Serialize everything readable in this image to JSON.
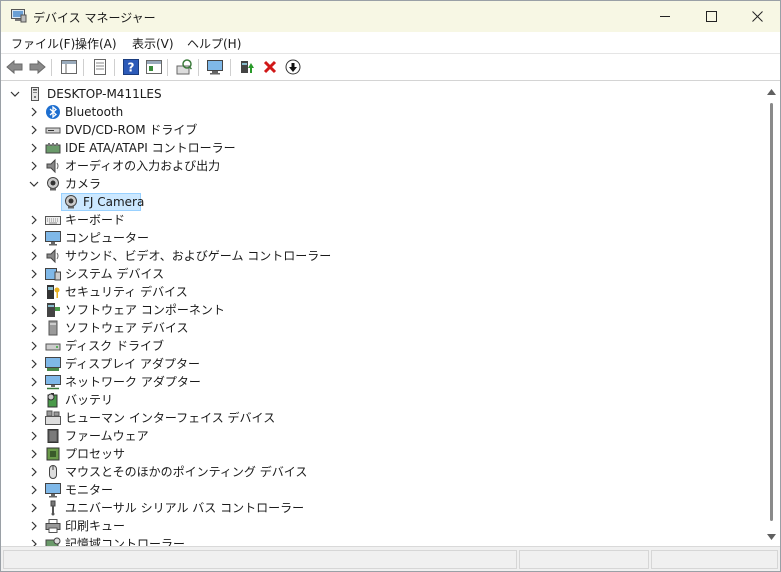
{
  "window": {
    "title": "デバイス マネージャー"
  },
  "menu": {
    "items": [
      "ファイル(F)",
      "操作(A)",
      "表示(V)",
      "ヘルプ(H)"
    ]
  },
  "toolbar": {
    "buttons": [
      "back-arrow-icon",
      "forward-arrow-icon",
      "show-hide-console-tree-icon",
      "properties-icon",
      "help-icon",
      "action-pane-icon",
      "update-driver-icon",
      "scan-hardware-icon",
      "enable-device-icon",
      "uninstall-device-icon",
      "disable-device-icon"
    ]
  },
  "tree": {
    "root": "DESKTOP-M411LES",
    "nodes": [
      {
        "label": "Bluetooth",
        "icon": "bluetooth-icon",
        "expanded": false
      },
      {
        "label": "DVD/CD-ROM ドライブ",
        "icon": "dvd-drive-icon",
        "expanded": false
      },
      {
        "label": "IDE ATA/ATAPI コントローラー",
        "icon": "ide-controller-icon",
        "expanded": false
      },
      {
        "label": "オーディオの入力および出力",
        "icon": "speaker-icon",
        "expanded": false
      },
      {
        "label": "カメラ",
        "icon": "camera-icon",
        "expanded": true
      },
      {
        "label": "FJ Camera",
        "icon": "webcam-icon",
        "child": true,
        "selected": true
      },
      {
        "label": "キーボード",
        "icon": "keyboard-icon",
        "expanded": false
      },
      {
        "label": "コンピューター",
        "icon": "computer-icon",
        "expanded": false
      },
      {
        "label": "サウンド、ビデオ、およびゲーム コントローラー",
        "icon": "sound-icon",
        "expanded": false
      },
      {
        "label": "システム デバイス",
        "icon": "system-device-icon",
        "expanded": false
      },
      {
        "label": "セキュリティ デバイス",
        "icon": "security-device-icon",
        "expanded": false
      },
      {
        "label": "ソフトウェア コンポーネント",
        "icon": "software-component-icon",
        "expanded": false
      },
      {
        "label": "ソフトウェア デバイス",
        "icon": "software-device-icon",
        "expanded": false
      },
      {
        "label": "ディスク ドライブ",
        "icon": "disk-drive-icon",
        "expanded": false
      },
      {
        "label": "ディスプレイ アダプター",
        "icon": "display-adapter-icon",
        "expanded": false
      },
      {
        "label": "ネットワーク アダプター",
        "icon": "network-adapter-icon",
        "expanded": false
      },
      {
        "label": "バッテリ",
        "icon": "battery-icon",
        "expanded": false
      },
      {
        "label": "ヒューマン インターフェイス デバイス",
        "icon": "hid-icon",
        "expanded": false
      },
      {
        "label": "ファームウェア",
        "icon": "firmware-icon",
        "expanded": false
      },
      {
        "label": "プロセッサ",
        "icon": "processor-icon",
        "expanded": false
      },
      {
        "label": "マウスとそのほかのポインティング デバイス",
        "icon": "mouse-icon",
        "expanded": false
      },
      {
        "label": "モニター",
        "icon": "monitor-icon",
        "expanded": false
      },
      {
        "label": "ユニバーサル シリアル バス コントローラー",
        "icon": "usb-icon",
        "expanded": false
      },
      {
        "label": "印刷キュー",
        "icon": "printer-icon",
        "expanded": false
      },
      {
        "label": "記憶域コントローラー",
        "icon": "storage-controller-icon",
        "expanded": false
      }
    ]
  },
  "colors": {
    "titlebar": "#f7f7e4",
    "selection": "#cce8ff",
    "selection_border": "#99d1ff"
  }
}
